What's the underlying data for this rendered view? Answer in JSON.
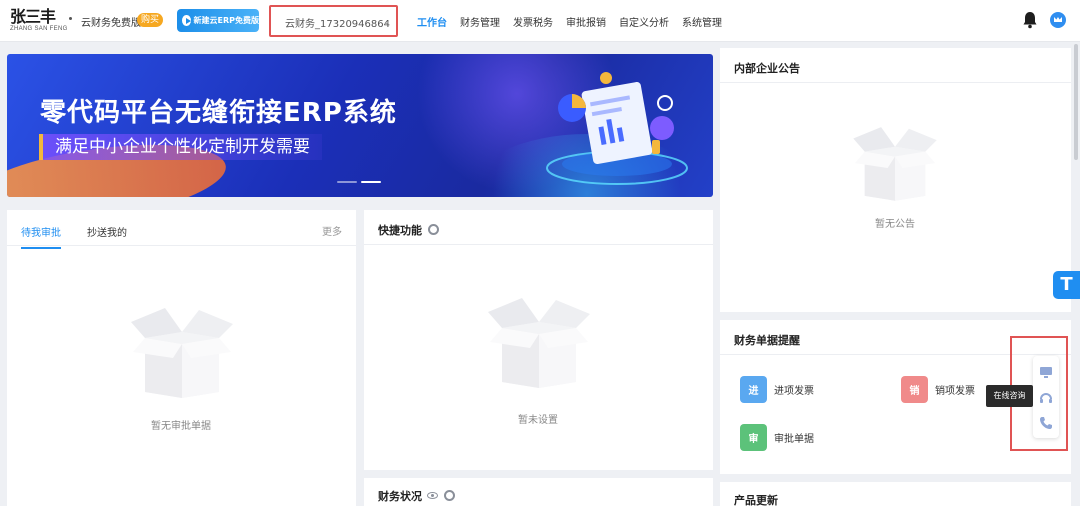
{
  "header": {
    "logo_text": "张三丰",
    "logo_sub": "ZHANG SAN FENG",
    "brand_name": "云财务免费版",
    "buy_label": "购买",
    "erp_button_label": "新建云ERP免费版",
    "company_select": "云财务_17320946864",
    "nav": [
      "工作台",
      "财务管理",
      "发票税务",
      "审批报销",
      "自定义分析",
      "系统管理"
    ],
    "active_nav": "工作台"
  },
  "banner": {
    "title": "零代码平台无缝衔接ERP系统",
    "subtitle": "满足中小企业个性化定制开发需要",
    "slides": 2,
    "active_slide": 2
  },
  "pending": {
    "tabs": [
      "待我审批",
      "抄送我的"
    ],
    "more_label": "更多",
    "empty_text": "暂无审批单据"
  },
  "quick": {
    "title": "快捷功能",
    "empty_text": "暂未设置"
  },
  "fin_status": {
    "title": "财务状况"
  },
  "notice": {
    "title": "内部企业公告",
    "empty_text": "暂无公告"
  },
  "reminder": {
    "title": "财务单据提醒",
    "items": [
      {
        "label": "进项发票",
        "icon_char": "进",
        "color": "#5aa8f0"
      },
      {
        "label": "销项发票",
        "icon_char": "销",
        "color": "#f08a8a"
      },
      {
        "label": "审批单据",
        "icon_char": "审",
        "color": "#5cc27a"
      }
    ]
  },
  "updates": {
    "title": "产品更新"
  },
  "floating": {
    "t_label": "T",
    "tooltip": "在线咨询"
  },
  "colors": {
    "accent": "#1f8ef1",
    "highlight_box": "#e05454"
  }
}
